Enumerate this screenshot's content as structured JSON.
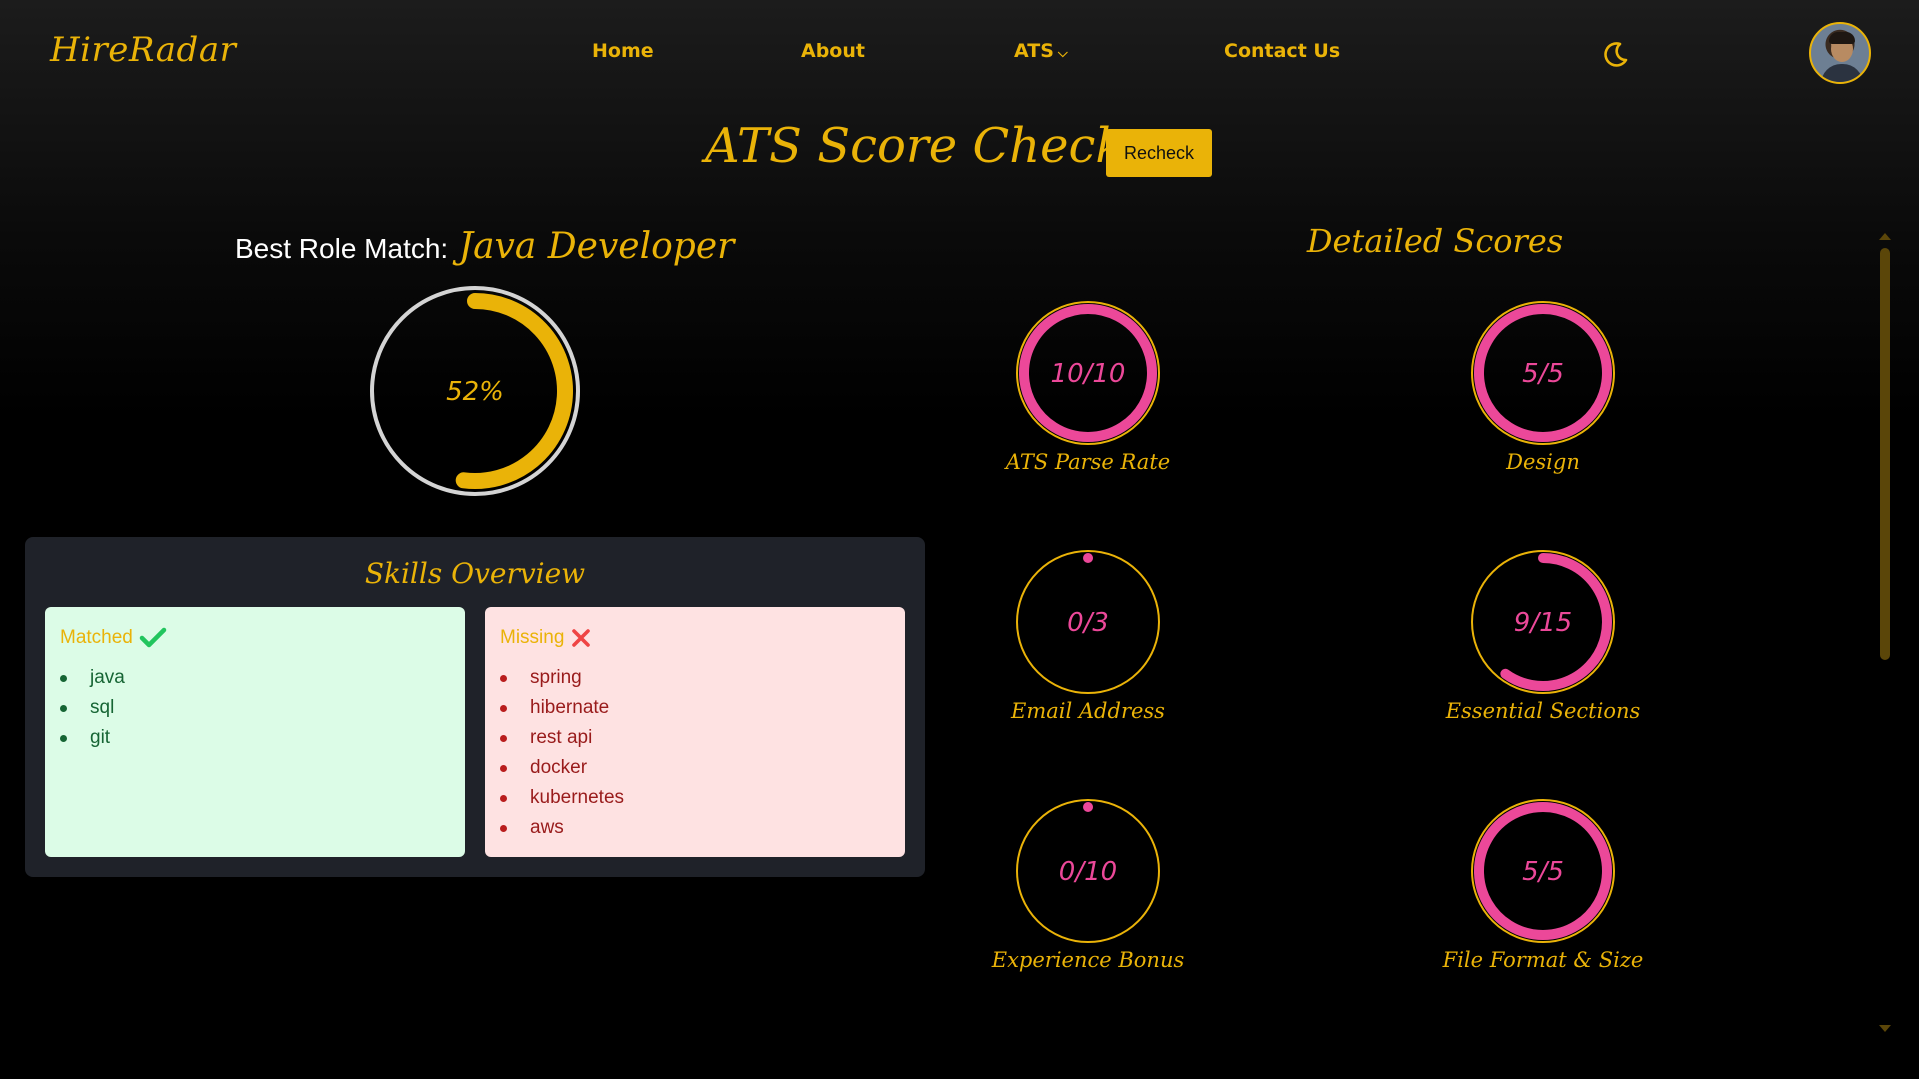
{
  "nav": {
    "brand": "HireRadar",
    "links": [
      {
        "label": "Home"
      },
      {
        "label": "About"
      },
      {
        "label": "ATS"
      },
      {
        "label": "Contact Us"
      }
    ],
    "theme_icon": "moon-icon",
    "ats_icon": "chevron-down-icon"
  },
  "header": {
    "title": "ATS Score Checker",
    "recheck_label": "Recheck"
  },
  "best_match": {
    "label": "Best Role Match:",
    "role": "Java Developer",
    "percent": 52,
    "percent_text": "52%"
  },
  "skills": {
    "title": "Skills Overview",
    "matched": {
      "label": "Matched",
      "icon": "check-icon",
      "items": [
        "java",
        "sql",
        "git"
      ]
    },
    "missing": {
      "label": "Missing",
      "icon": "cross-icon",
      "items": [
        "spring",
        "hibernate",
        "rest api",
        "docker",
        "kubernetes",
        "aws"
      ]
    }
  },
  "detailed": {
    "title": "Detailed Scores",
    "scores": [
      {
        "label": "ATS Parse Rate",
        "value": 10,
        "max": 10,
        "text": "10/10"
      },
      {
        "label": "Design",
        "value": 5,
        "max": 5,
        "text": "5/5"
      },
      {
        "label": "Email Address",
        "value": 0,
        "max": 3,
        "text": "0/3"
      },
      {
        "label": "Essential Sections",
        "value": 9,
        "max": 15,
        "text": "9/15"
      },
      {
        "label": "Experience Bonus",
        "value": 0,
        "max": 10,
        "text": "0/10"
      },
      {
        "label": "File Format & Size",
        "value": 5,
        "max": 5,
        "text": "5/5"
      }
    ]
  },
  "colors": {
    "accent": "#eab308",
    "score_ring": "#ec4899",
    "matched_bg": "#dcfce7",
    "missing_bg": "#fee2e2",
    "card_bg": "#1f2229"
  }
}
